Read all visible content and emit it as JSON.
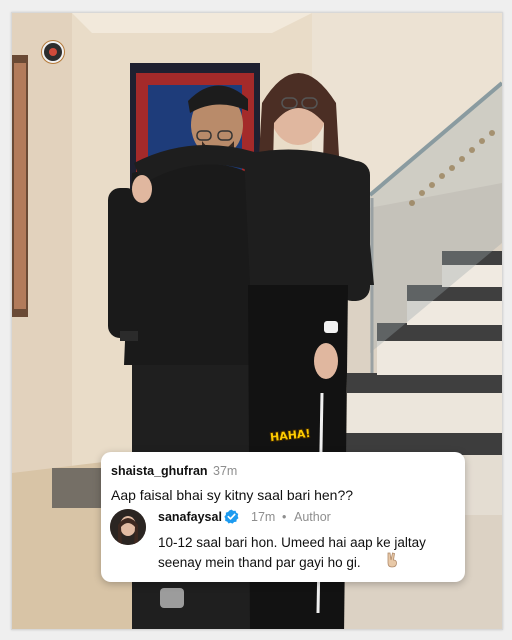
{
  "overlay": {
    "sticker_text": "HAHA!"
  },
  "comment": {
    "username": "shaista_ghufran",
    "time": "37m",
    "text": "Aap faisal bhai sy kitny saal bari hen??"
  },
  "reply": {
    "username": "sanafaysal",
    "time": "17m",
    "separator": "•",
    "badge": "Author",
    "text": "10-12 saal bari hon. Umeed hai aap ke jaltay seenay mein thand par gayi ho gi.",
    "verified_icon": "verified-badge-icon",
    "emoji_icon": "peace-hand-icon"
  },
  "colors": {
    "verified_blue": "#1d9bf0",
    "muted_text": "#8e8e8e",
    "card_bg": "#ffffff"
  }
}
